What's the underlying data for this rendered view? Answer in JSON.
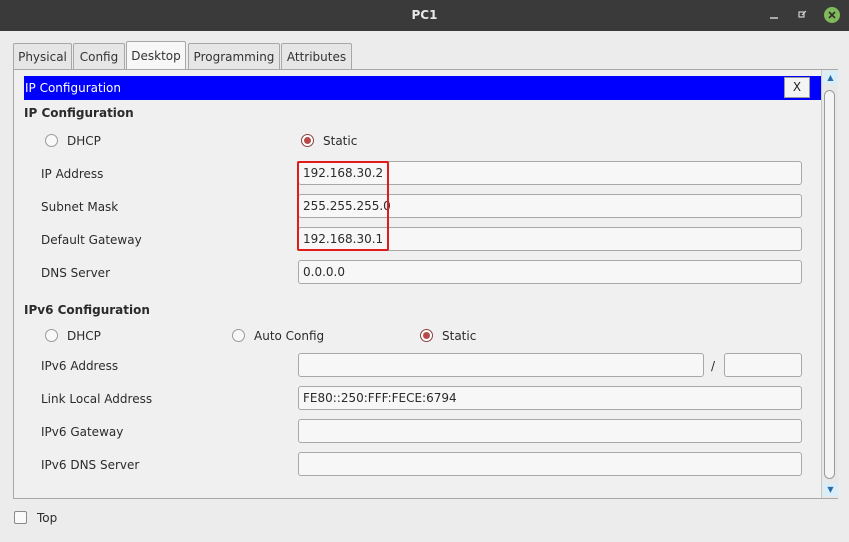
{
  "window": {
    "title": "PC1"
  },
  "tabs": [
    {
      "label": "Physical",
      "active": false
    },
    {
      "label": "Config",
      "active": false
    },
    {
      "label": "Desktop",
      "active": true
    },
    {
      "label": "Programming",
      "active": false
    },
    {
      "label": "Attributes",
      "active": false
    }
  ],
  "ip_config": {
    "header_title": "IP Configuration",
    "close_label": "X",
    "ipv4": {
      "heading": "IP Configuration",
      "mode_options": [
        {
          "label": "DHCP",
          "selected": false
        },
        {
          "label": "Static",
          "selected": true
        }
      ],
      "fields": {
        "ip_address": {
          "label": "IP Address",
          "value": "192.168.30.2"
        },
        "subnet_mask": {
          "label": "Subnet Mask",
          "value": "255.255.255.0"
        },
        "default_gateway": {
          "label": "Default Gateway",
          "value": "192.168.30.1"
        },
        "dns_server": {
          "label": "DNS Server",
          "value": "0.0.0.0"
        }
      }
    },
    "ipv6": {
      "heading": "IPv6 Configuration",
      "mode_options": [
        {
          "label": "DHCP",
          "selected": false
        },
        {
          "label": "Auto Config",
          "selected": false
        },
        {
          "label": "Static",
          "selected": true
        }
      ],
      "fields": {
        "ipv6_address": {
          "label": "IPv6 Address",
          "value": "",
          "separator": "/",
          "prefix_value": ""
        },
        "link_local_address": {
          "label": "Link Local Address",
          "value": "FE80::250:FFF:FECE:6794"
        },
        "ipv6_gateway": {
          "label": "IPv6 Gateway",
          "value": ""
        },
        "ipv6_dns_server": {
          "label": "IPv6 DNS Server",
          "value": ""
        }
      }
    }
  },
  "bottom_bar": {
    "top_label": "Top",
    "top_checked": false
  },
  "colors": {
    "titlebar": "#3a3a3a",
    "section_header": "#0000ff",
    "highlight_box": "#e01b1b",
    "radio_selected": "#b94a4a"
  },
  "icons": [
    "minimize-icon",
    "restore-icon",
    "close-icon",
    "scroll-up-icon",
    "scroll-down-icon"
  ]
}
